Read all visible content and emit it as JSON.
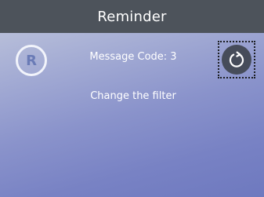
{
  "header": {
    "title": "Reminder"
  },
  "badge": {
    "letter": "R"
  },
  "message": {
    "code_text": "Message Code: 3",
    "text": "Change the filter"
  },
  "reset_button": {
    "icon": "reset-icon"
  }
}
